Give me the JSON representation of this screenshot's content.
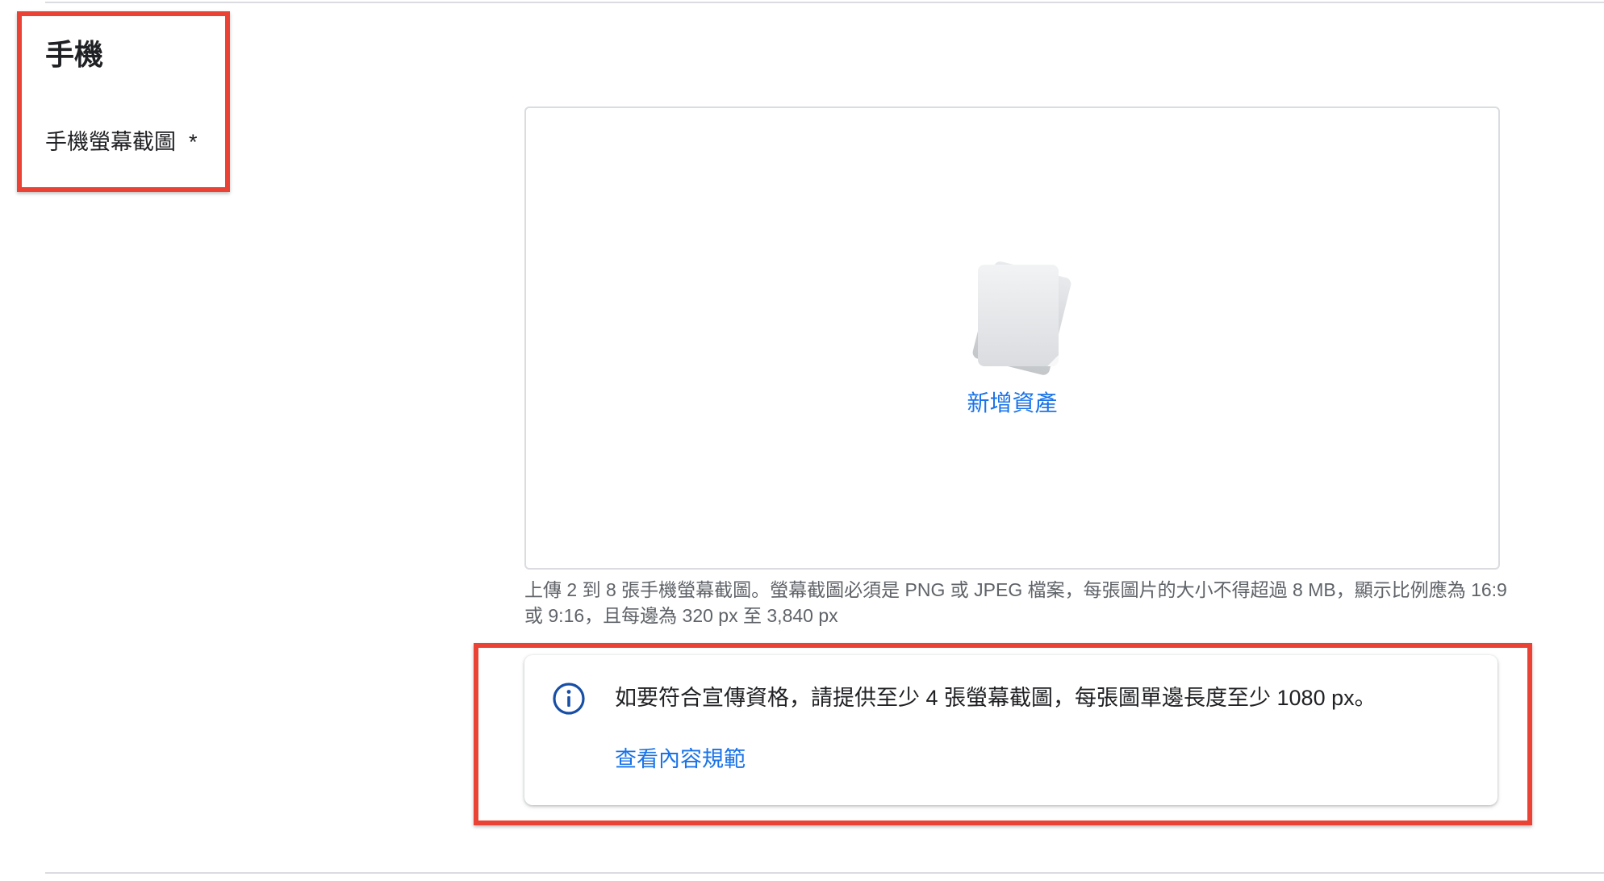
{
  "section": {
    "title": "手機",
    "field_label": "手機螢幕截圖",
    "required_marker": "*"
  },
  "upload": {
    "add_asset_label": "新增資產",
    "helper_text": "上傳 2 到 8 張手機螢幕截圖。螢幕截圖必須是 PNG 或 JPEG 檔案，每張圖片的大小不得超過 8 MB，顯示比例應為 16:9 或 9:16，且每邊為 320 px 至 3,840 px"
  },
  "info_card": {
    "message": "如要符合宣傳資格，請提供至少 4 張螢幕截圖，每張圖單邊長度至少 1080 px。",
    "link_label": "查看內容規範"
  },
  "colors": {
    "link": "#1a73e8",
    "highlight": "#ea4335",
    "info_icon": "#174ea6"
  }
}
